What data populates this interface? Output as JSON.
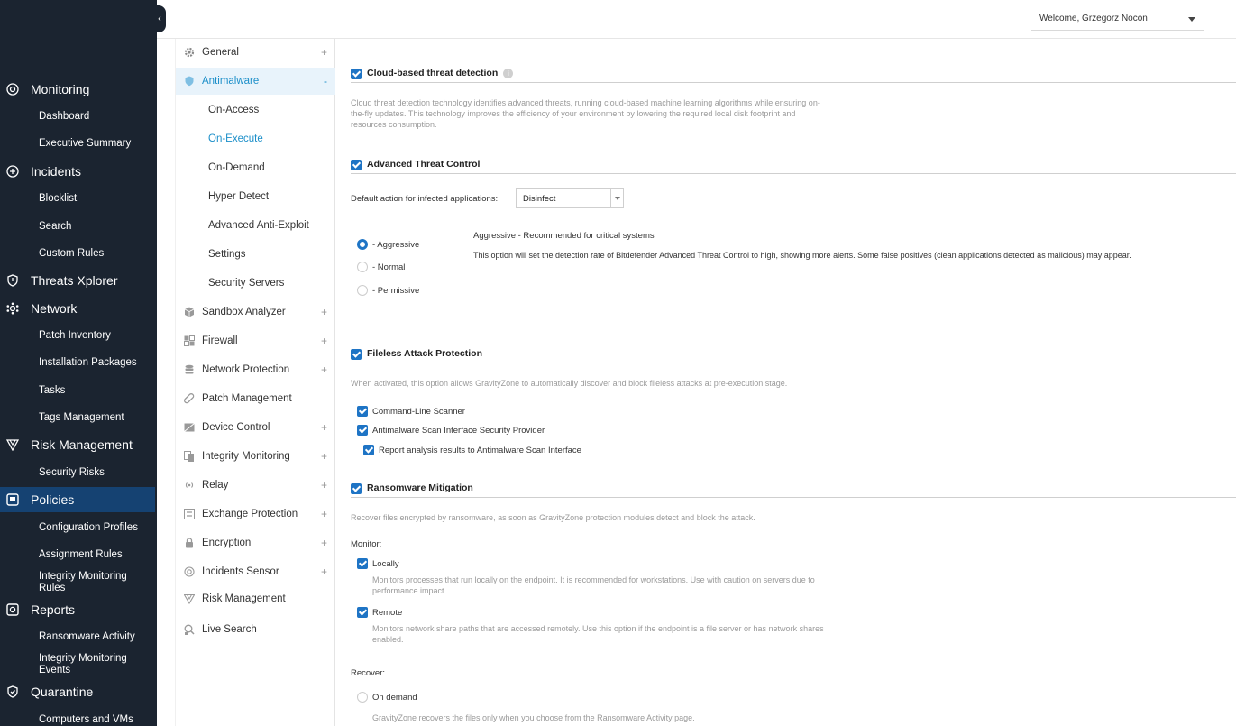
{
  "header": {
    "welcome": "Welcome, Grzegorz Nocon"
  },
  "nav": {
    "monitoring": "Monitoring",
    "dashboard": "Dashboard",
    "executive_summary": "Executive Summary",
    "incidents": "Incidents",
    "blocklist": "Blocklist",
    "search": "Search",
    "custom_rules": "Custom Rules",
    "threats_xplorer": "Threats Xplorer",
    "network": "Network",
    "patch_inventory": "Patch Inventory",
    "installation_packages": "Installation Packages",
    "tasks": "Tasks",
    "tags_management": "Tags Management",
    "risk_management": "Risk Management",
    "security_risks": "Security Risks",
    "policies": "Policies",
    "configuration_profiles": "Configuration Profiles",
    "assignment_rules": "Assignment Rules",
    "integrity_monitoring_rules": "Integrity Monitoring Rules",
    "reports": "Reports",
    "ransomware_activity": "Ransomware Activity",
    "integrity_monitoring_events": "Integrity Monitoring Events",
    "quarantine": "Quarantine",
    "computers_and_vms": "Computers and VMs"
  },
  "sections": {
    "general": "General",
    "antimalware": "Antimalware",
    "on_access": "On-Access",
    "on_execute": "On-Execute",
    "on_demand": "On-Demand",
    "hyper_detect": "Hyper Detect",
    "advanced_anti_exploit": "Advanced Anti-Exploit",
    "settings": "Settings",
    "security_servers": "Security Servers",
    "sandbox_analyzer": "Sandbox Analyzer",
    "firewall": "Firewall",
    "network_protection": "Network Protection",
    "patch_management": "Patch Management",
    "device_control": "Device Control",
    "integrity_monitoring": "Integrity Monitoring",
    "relay": "Relay",
    "exchange_protection": "Exchange Protection",
    "encryption": "Encryption",
    "incidents_sensor": "Incidents Sensor",
    "risk_management": "Risk Management",
    "live_search": "Live Search",
    "plus": "+",
    "minus": "-"
  },
  "content": {
    "cloud": {
      "title": "Cloud-based threat detection",
      "info": "i",
      "desc_1": "Cloud threat detection technology identifies advanced threats, running cloud-based machine learning algorithms while ensuring on-",
      "desc_2": "the-fly updates. This technology improves the efficiency of your environment by lowering the required local disk footprint and",
      "desc_3": "resources consumption."
    },
    "atc": {
      "title": "Advanced Threat Control",
      "default_action_label": "Default action for infected applications:",
      "default_action_value": "Disinfect",
      "radio_aggressive": "- Aggressive",
      "radio_normal": "- Normal",
      "radio_permissive": "- Permissive",
      "level_title": "Aggressive - Recommended for critical systems",
      "level_desc": "This option will set the detection rate of Bitdefender Advanced Threat Control to high, showing more alerts. Some false positives (clean applications detected as malicious) may appear."
    },
    "fileless": {
      "title": "Fileless Attack Protection",
      "desc": "When activated, this option allows GravityZone to automatically discover and block fileless attacks at pre-execution stage.",
      "cmd_scanner": "Command-Line Scanner",
      "amsi_provider": "Antimalware Scan Interface Security Provider",
      "report_amsi": "Report analysis results to Antimalware Scan Interface"
    },
    "ransomware": {
      "title": "Ransomware Mitigation",
      "desc": "Recover files encrypted by ransomware, as soon as GravityZone protection modules detect and block the attack.",
      "monitor_label": "Monitor:",
      "locally": "Locally",
      "locally_desc_1": "Monitors processes that run locally on the endpoint. It is recommended for workstations. Use with caution on servers due to",
      "locally_desc_2": "performance impact.",
      "remote": "Remote",
      "remote_desc_1": "Monitors network share paths that are accessed remotely. Use this option if the endpoint is a file server or has network shares",
      "remote_desc_2": "enabled.",
      "recover_label": "Recover:",
      "on_demand": "On demand",
      "on_demand_desc": "GravityZone recovers the files only when you choose from the Ransomware Activity page."
    }
  }
}
